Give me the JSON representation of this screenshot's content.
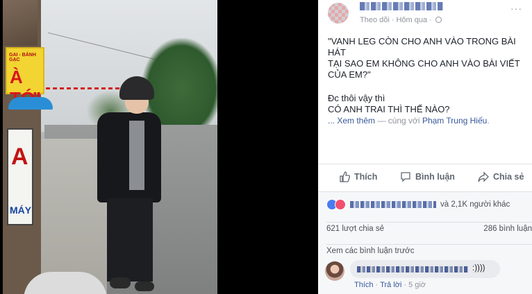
{
  "photo": {
    "sign_top_small": "GAI - BÁNH GẠC",
    "sign_top_big": "À TỚI",
    "sign_low_big": "A",
    "sign_low_bottom": "MÁY"
  },
  "post": {
    "follow_label": "Theo dõi",
    "time_label": "Hôm qua",
    "text_quote": "\"VANH LEG CÒN CHO ANH VÀO TRONG BÀI HÁT\nTẠI SAO EM KHÔNG CHO ANH VÀO BÀI VIẾT\nCỦA EM?\"",
    "text_line2": "Đc thôi vậy thì",
    "text_line3": "CÓ ANH TRAI THÌ THẾ NÀO?",
    "see_more": "... Xem thêm",
    "with_sep": " — cùng với ",
    "tagged": "Phạm Trung Hiếu",
    "tagged_end": "."
  },
  "actions": {
    "like": "Thích",
    "comment": "Bình luận",
    "share": "Chia sẻ"
  },
  "reactions": {
    "others_text": "và 2,1K người khác"
  },
  "stats": {
    "shares": "621 lượt chia sẻ",
    "comments": "286 bình luận"
  },
  "comments": {
    "view_previous": "Xem các bình luận trước",
    "item": {
      "text_tail": ":))))",
      "like": "Thích",
      "reply": "Trả lời",
      "time": "5 giờ"
    }
  }
}
